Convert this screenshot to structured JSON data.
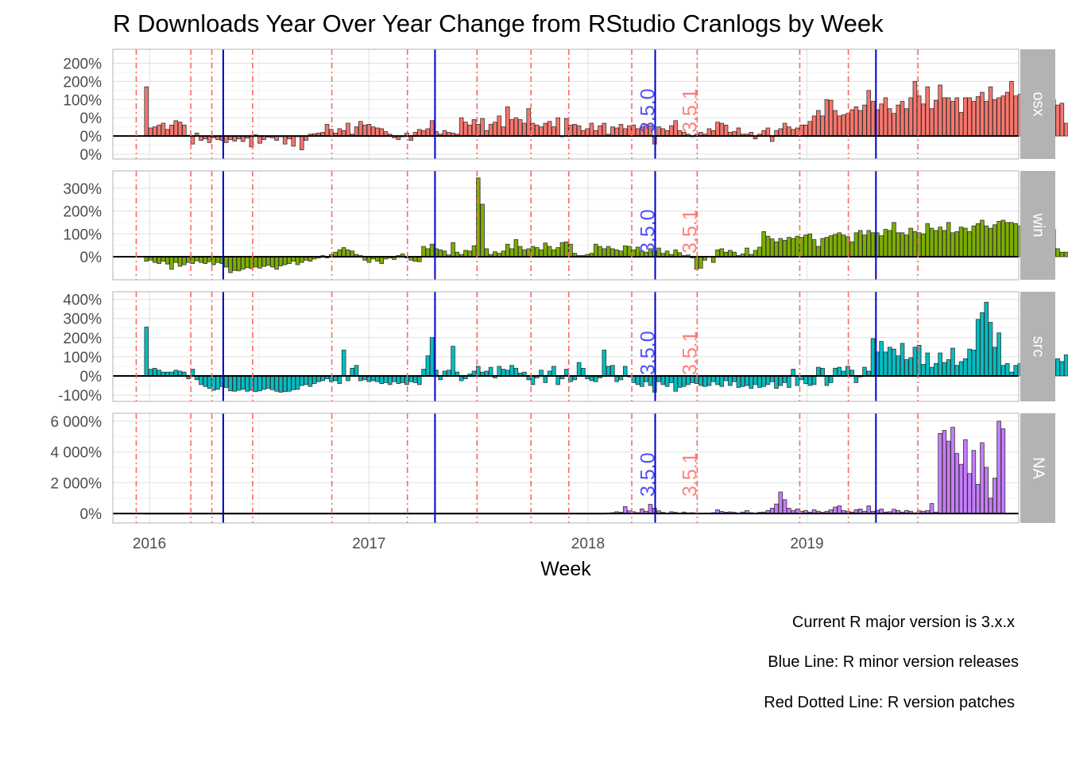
{
  "chart_data": {
    "type": "bar",
    "title": "R Downloads Year Over Year Change from RStudio Cranlogs by Week",
    "xlabel": "Week",
    "ylabel": "",
    "x_range": [
      "2015-11-01",
      "2019-12-20"
    ],
    "x_ticks": [
      {
        "date": "2016-01-01",
        "label": "2016"
      },
      {
        "date": "2017-01-01",
        "label": "2017"
      },
      {
        "date": "2018-01-01",
        "label": "2018"
      },
      {
        "date": "2019-01-01",
        "label": "2019"
      }
    ],
    "minor_releases": [
      "2016-05-03",
      "2017-04-21",
      "2018-04-23",
      "2019-04-26"
    ],
    "patch_releases": [
      "2015-12-10",
      "2016-03-10",
      "2016-04-14",
      "2016-06-21",
      "2016-10-31",
      "2017-03-06",
      "2017-06-30",
      "2017-09-28",
      "2017-11-30",
      "2018-03-15",
      "2018-07-02",
      "2018-12-20",
      "2019-03-11",
      "2019-07-05"
    ],
    "version_labels": [
      {
        "date": "2018-04-23",
        "text": "3.5.0",
        "color": "#5050ff"
      },
      {
        "date": "2018-07-02",
        "text": "3.5.1",
        "color": "#ff8080"
      }
    ],
    "grid": true,
    "captions": [
      "Current R major version is 3.x.x",
      "Blue Line: R minor version releases",
      "Red Dotted Line: R version patches"
    ],
    "colors": {
      "minor_release": "#0000cc",
      "patch_release": "#ff6666",
      "strip": "#b3b3b3",
      "bar_outline": "#333333"
    },
    "panels": [
      {
        "name": "osx",
        "color": "#f8766d",
        "ylim": [
          -0.5,
          2.25
        ],
        "y_ticks": [
          {
            "v": -0.5,
            "label": "0%"
          },
          {
            "v": 0,
            "label": "0%"
          },
          {
            "v": 0.5,
            "label": "0%"
          },
          {
            "v": 1,
            "label": "100%"
          },
          {
            "v": 1.5,
            "label": "200%"
          },
          {
            "v": 2,
            "label": "200%"
          }
        ],
        "start": "2015-12-27",
        "values": [
          1.35,
          0.22,
          0.25,
          0.3,
          0.35,
          0.18,
          0.3,
          0.42,
          0.38,
          0.3,
          0.02,
          -0.22,
          0.08,
          -0.12,
          -0.08,
          -0.18,
          -0.05,
          -0.1,
          -0.12,
          -0.18,
          -0.1,
          -0.14,
          -0.08,
          -0.15,
          -0.06,
          -0.3,
          0.03,
          -0.2,
          -0.1,
          -0.03,
          -0.05,
          -0.12,
          -0.02,
          -0.22,
          -0.08,
          -0.28,
          -0.02,
          -0.38,
          -0.12,
          0.05,
          0.06,
          0.08,
          0.1,
          0.32,
          0.18,
          0.08,
          0.2,
          0.15,
          0.35,
          0.05,
          0.25,
          0.4,
          0.3,
          0.32,
          0.25,
          0.22,
          0.2,
          0.12,
          0.05,
          -0.05,
          -0.1,
          -0.02,
          0.08,
          -0.12,
          0.1,
          0.18,
          0.15,
          0.2,
          0.42,
          0.12,
          0.05,
          0.15,
          0.1,
          0.08,
          0.05,
          0.5,
          0.38,
          0.3,
          0.45,
          0.32,
          0.48,
          0.15,
          0.32,
          0.38,
          0.55,
          0.25,
          0.8,
          0.45,
          0.5,
          0.45,
          0.35,
          0.75,
          0.35,
          0.3,
          0.25,
          0.35,
          0.4,
          0.25,
          0.5,
          -0.02,
          0.48,
          0.3,
          0.32,
          0.28,
          0.15,
          0.2,
          0.35,
          0.15,
          0.28,
          0.35,
          0.05,
          0.25,
          0.22,
          0.32,
          0.2,
          0.28,
          0.3,
          0.2,
          0.25,
          0.32,
          0.28,
          -0.22,
          0.25,
          0.2,
          0.15,
          0.28,
          0.42,
          0.15,
          0.1,
          0.05,
          -0.02,
          0.05,
          0.1,
          0.05,
          0.2,
          0.15,
          0.38,
          0.35,
          0.3,
          0.1,
          0.12,
          0.22,
          0.05,
          0.05,
          0.1,
          -0.08,
          0.05,
          0.15,
          0.22,
          -0.15,
          0.15,
          0.2,
          0.35,
          0.25,
          0.18,
          0.22,
          0.3,
          0.3,
          0.4,
          0.55,
          0.7,
          0.55,
          1.0,
          0.98,
          0.7,
          0.55,
          0.58,
          0.62,
          0.72,
          0.8,
          0.7,
          0.85,
          1.25,
          0.95,
          0.72,
          0.88,
          1.05,
          0.75,
          0.62,
          0.85,
          0.95,
          0.75,
          1.05,
          1.5,
          1.1,
          0.88,
          1.35,
          0.75,
          0.98,
          1.4,
          1.05,
          1.05,
          0.95,
          1.05,
          0.65,
          1.05,
          1.05,
          0.95,
          1.08,
          1.2,
          0.95,
          1.35,
          1.0,
          1.05,
          1.1,
          1.2,
          1.5,
          1.1,
          1.15,
          2.15,
          1.65,
          1.45,
          1.12,
          1.3,
          0.95,
          1.35,
          1.0,
          0.85,
          0.9,
          0.35,
          0.15,
          0.25,
          -0.05,
          0.38,
          0.05
        ]
      },
      {
        "name": "win",
        "color": "#7cae00",
        "ylim": [
          -0.8,
          3.55
        ],
        "y_ticks": [
          {
            "v": 0,
            "label": "0%"
          },
          {
            "v": 1,
            "label": "100%"
          },
          {
            "v": 2,
            "label": "200%"
          },
          {
            "v": 3,
            "label": "300%"
          }
        ],
        "start": "2015-12-27",
        "values": [
          -0.2,
          -0.15,
          -0.25,
          -0.3,
          -0.2,
          -0.32,
          -0.55,
          -0.25,
          -0.42,
          -0.35,
          -0.25,
          -0.3,
          -0.18,
          -0.25,
          -0.3,
          -0.22,
          -0.35,
          -0.25,
          -0.3,
          -0.45,
          -0.7,
          -0.6,
          -0.62,
          -0.55,
          -0.48,
          -0.52,
          -0.45,
          -0.5,
          -0.42,
          -0.38,
          -0.45,
          -0.55,
          -0.4,
          -0.35,
          -0.3,
          -0.2,
          -0.35,
          -0.25,
          -0.15,
          -0.2,
          -0.1,
          -0.05,
          0.05,
          -0.05,
          0.1,
          0.2,
          0.3,
          0.4,
          0.3,
          0.25,
          0.1,
          0.05,
          -0.15,
          -0.25,
          -0.1,
          -0.2,
          -0.3,
          -0.1,
          -0.05,
          -0.12,
          0.05,
          0.12,
          -0.05,
          -0.15,
          -0.2,
          -0.22,
          0.45,
          0.35,
          0.55,
          0.35,
          0.3,
          0.25,
          0.08,
          0.62,
          0.2,
          0.1,
          0.28,
          0.25,
          0.48,
          3.45,
          2.3,
          0.35,
          0.1,
          0.22,
          0.15,
          0.25,
          0.55,
          0.35,
          0.75,
          0.45,
          0.3,
          0.35,
          0.45,
          0.4,
          0.3,
          0.6,
          0.45,
          0.3,
          0.4,
          0.62,
          0.65,
          0.55,
          0.15,
          0.05,
          0.05,
          0.1,
          0.15,
          0.55,
          0.45,
          0.35,
          0.45,
          0.35,
          0.3,
          0.25,
          0.48,
          0.45,
          0.3,
          0.42,
          0.25,
          0.2,
          0.35,
          0.25,
          0.38,
          0.15,
          0.25,
          0.1,
          0.3,
          0.18,
          0.05,
          0.08,
          -0.05,
          -0.55,
          -0.5,
          -0.15,
          -0.02,
          -0.25,
          0.3,
          0.35,
          0.2,
          0.28,
          0.2,
          0.05,
          0.12,
          0.38,
          0.1,
          0.28,
          0.42,
          1.1,
          0.9,
          0.78,
          0.65,
          0.8,
          0.72,
          0.85,
          0.8,
          0.9,
          0.85,
          0.95,
          1.0,
          0.75,
          0.45,
          0.8,
          0.85,
          0.92,
          0.98,
          1.05,
          0.95,
          0.88,
          0.65,
          1.05,
          1.15,
          0.95,
          1.15,
          1.05,
          1.05,
          0.92,
          1.2,
          1.15,
          1.5,
          1.05,
          1.05,
          0.95,
          1.25,
          1.1,
          1.05,
          1.0,
          1.45,
          1.25,
          1.15,
          1.3,
          1.15,
          1.5,
          1.05,
          1.1,
          1.3,
          1.25,
          1.1,
          1.35,
          1.45,
          1.6,
          1.35,
          1.25,
          1.4,
          1.55,
          1.6,
          1.5,
          1.5,
          1.45,
          1.35,
          1.2,
          1.65,
          1.2,
          1.15,
          1.7,
          1.3,
          1.45,
          1.2,
          0.35,
          0.2,
          0.2,
          0.1,
          0.25,
          0.1
        ]
      },
      {
        "name": "src",
        "color": "#00bfc4",
        "ylim": [
          -1.08,
          4.15
        ],
        "y_ticks": [
          {
            "v": -1,
            "label": "-100%"
          },
          {
            "v": 0,
            "label": "0%"
          },
          {
            "v": 1,
            "label": "100%"
          },
          {
            "v": 2,
            "label": "200%"
          },
          {
            "v": 3,
            "label": "300%"
          },
          {
            "v": 4,
            "label": "400%"
          }
        ],
        "start": "2015-12-27",
        "values": [
          2.55,
          0.35,
          0.4,
          0.3,
          0.2,
          0.2,
          0.2,
          0.3,
          0.25,
          0.2,
          -0.15,
          0.35,
          -0.2,
          -0.45,
          -0.55,
          -0.65,
          -0.75,
          -0.7,
          -0.55,
          -0.6,
          -0.78,
          -0.8,
          -0.75,
          -0.7,
          -0.8,
          -0.75,
          -0.82,
          -0.78,
          -0.7,
          -0.65,
          -0.72,
          -0.8,
          -0.85,
          -0.82,
          -0.8,
          -0.72,
          -0.7,
          -0.5,
          -0.45,
          -0.55,
          -0.4,
          -0.3,
          -0.25,
          -0.15,
          -0.3,
          -0.25,
          -0.4,
          1.35,
          -0.25,
          0.4,
          0.55,
          -0.25,
          -0.2,
          -0.3,
          -0.25,
          -0.3,
          -0.4,
          -0.35,
          -0.45,
          -0.3,
          -0.4,
          -0.35,
          -0.45,
          -0.3,
          -0.35,
          -0.45,
          0.35,
          1.05,
          2.0,
          0.3,
          -0.2,
          0.25,
          0.3,
          1.55,
          0.2,
          -0.25,
          -0.15,
          0.1,
          0.25,
          0.5,
          0.2,
          0.25,
          0.45,
          -0.1,
          0.5,
          0.35,
          0.3,
          0.55,
          0.4,
          0.15,
          0.2,
          -0.2,
          -0.45,
          -0.1,
          0.3,
          -0.35,
          0.25,
          0.5,
          -0.45,
          -0.15,
          0.35,
          -0.3,
          -0.2,
          0.7,
          0.4,
          -0.15,
          -0.25,
          -0.3,
          -0.1,
          1.35,
          0.5,
          0.55,
          -0.3,
          -0.2,
          0.5,
          -0.05,
          -0.35,
          -0.45,
          -0.55,
          -0.3,
          -0.5,
          -0.85,
          -0.3,
          -0.45,
          -0.55,
          -0.35,
          -0.8,
          -0.6,
          -0.55,
          -0.45,
          -0.35,
          -0.4,
          -0.5,
          -0.55,
          -0.5,
          -0.3,
          -0.45,
          -0.55,
          -0.25,
          -0.5,
          -0.3,
          -0.6,
          -0.55,
          -0.5,
          -0.65,
          -0.45,
          -0.6,
          -0.55,
          -0.45,
          -0.3,
          -0.65,
          -0.5,
          -0.35,
          -0.6,
          0.35,
          -0.5,
          -0.2,
          -0.4,
          -0.5,
          -0.45,
          0.45,
          0.4,
          -0.5,
          -0.35,
          0.4,
          0.45,
          0.25,
          0.5,
          0.3,
          -0.35,
          -0.05,
          0.45,
          0.25,
          1.95,
          1.25,
          1.8,
          1.25,
          1.5,
          1.4,
          1.05,
          1.7,
          0.85,
          0.95,
          1.5,
          1.6,
          0.6,
          1.2,
          0.45,
          0.65,
          1.2,
          0.7,
          0.85,
          1.45,
          0.55,
          0.75,
          0.9,
          1.4,
          1.35,
          2.95,
          3.3,
          3.85,
          2.8,
          1.5,
          2.25,
          0.55,
          0.65,
          0.2,
          0.55,
          0.65,
          0.75,
          0.7,
          0.35,
          0.45,
          1.3,
          1.15,
          1.6,
          0.85,
          0.9,
          0.75,
          1.1,
          0.45,
          0.95,
          1.85,
          0.65,
          0.3,
          -0.1,
          0.2,
          0.15,
          0.25,
          0.1
        ]
      },
      {
        "name": "NA",
        "color": "#c77cff",
        "ylim": [
          -300,
          6200
        ],
        "y_ticks": [
          {
            "v": 0,
            "label": "0%"
          },
          {
            "v": 2000,
            "label": "2 000%"
          },
          {
            "v": 4000,
            "label": "4 000%"
          },
          {
            "v": 6000,
            "label": "6 000%"
          }
        ],
        "start": "2015-12-27",
        "values": [
          0,
          0,
          0,
          0,
          0,
          0,
          0,
          0,
          0,
          0,
          0,
          0,
          0,
          0,
          0,
          0,
          0,
          0,
          0,
          0,
          0,
          0,
          0,
          0,
          0,
          0,
          0,
          0,
          0,
          0,
          0,
          0,
          0,
          0,
          0,
          0,
          0,
          0,
          0,
          0,
          0,
          0,
          0,
          0,
          0,
          0,
          0,
          0,
          0,
          0,
          0,
          0,
          0,
          0,
          0,
          0,
          0,
          0,
          0,
          0,
          0,
          0,
          0,
          0,
          0,
          0,
          0,
          0,
          0,
          0,
          0,
          0,
          0,
          0,
          0,
          0,
          0,
          0,
          0,
          0,
          0,
          0,
          0,
          0,
          0,
          0,
          0,
          0,
          0,
          0,
          0,
          0,
          0,
          0,
          0,
          0,
          0,
          0,
          0,
          0,
          0,
          0,
          0,
          0,
          0,
          0,
          0,
          0,
          0,
          0,
          40,
          60,
          120,
          80,
          450,
          180,
          120,
          60,
          300,
          150,
          600,
          350,
          180,
          80,
          30,
          120,
          80,
          40,
          100,
          50,
          60,
          30,
          20,
          40,
          30,
          60,
          250,
          140,
          90,
          110,
          80,
          40,
          100,
          200,
          60,
          30,
          80,
          100,
          200,
          350,
          620,
          1400,
          900,
          350,
          200,
          300,
          150,
          200,
          100,
          250,
          150,
          80,
          150,
          250,
          420,
          500,
          200,
          150,
          100,
          250,
          300,
          150,
          500,
          150,
          200,
          300,
          100,
          120,
          280,
          200,
          100,
          200,
          150,
          50,
          180,
          150,
          200,
          650,
          100,
          5200,
          5400,
          4700,
          5600,
          3900,
          3200,
          4800,
          2600,
          4100,
          1900,
          4600,
          3000,
          1000,
          2300,
          6000,
          5500
        ]
      }
    ]
  }
}
